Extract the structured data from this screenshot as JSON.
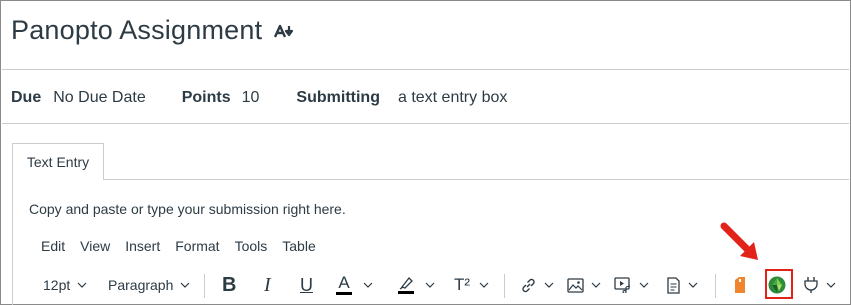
{
  "assignment": {
    "title": "Panopto Assignment"
  },
  "details": {
    "due_label": "Due",
    "due_value": "No Due Date",
    "points_label": "Points",
    "points_value": "10",
    "submitting_label": "Submitting",
    "submitting_value": "a text entry box"
  },
  "tabs": [
    {
      "label": "Text Entry"
    }
  ],
  "editor": {
    "instructions": "Copy and paste or type your submission right here.",
    "menu": [
      "Edit",
      "View",
      "Insert",
      "Format",
      "Tools",
      "Table"
    ],
    "font_size": "12pt",
    "block_format": "Paragraph",
    "bold_glyph": "B",
    "italic_glyph": "I",
    "underline_glyph": "U",
    "font_color_glyph": "A",
    "superscript_glyph": "T²"
  },
  "colors": {
    "text": "#2d3b45",
    "divider": "#c7cdd1",
    "highlight": "#e2231a",
    "panopto_green": "#2e8b3a",
    "orange_tool": "#f0852d"
  }
}
